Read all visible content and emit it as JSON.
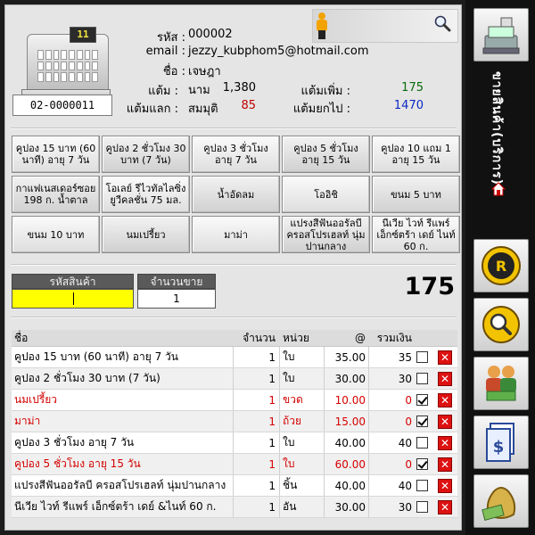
{
  "member": {
    "code_label": "รหัส :",
    "code": "000002",
    "email_label": "email :",
    "email": "jezzy_kubphom5@hotmail.com",
    "name_label": "ชื่อ :",
    "name": "เจษฎา นามสมมุติ",
    "points_label": "แต้ม :",
    "points": "1,380",
    "points_add_label": "แต้มเพิ่ม :",
    "points_add": "175",
    "points_redeem_label": "แต้มแลก :",
    "points_redeem": "85",
    "points_forward_label": "แต้มยกไป :",
    "points_forward": "1470",
    "accent_green": "#0a6a0a",
    "accent_red": "#c00000",
    "accent_blue": "#0b2ac2"
  },
  "register": {
    "display": "11",
    "terminal_id": "02-0000011"
  },
  "products": [
    "คูปอง 15 บาท (60 นาที) อายุ 7 วัน",
    "คูปอง 2 ชั่วโมง 30 บาท (7 วัน)",
    "คูปอง 3 ชั่วโมง อายุ 7 วัน",
    "คูปอง 5 ชั่วโมง อายุ 15 วัน",
    "คูปอง 10 แถม 1 อายุ 15 วัน",
    "กาแฟเนสเดอร์ซอย 198 ก. น้ำตาล",
    "โอเลย์ รีไวทัลไลซิ่ง ยูวีคลชั่น 75 มล.",
    "น้ำอัดลม",
    "โออิชิ",
    "ขนม 5 บาท",
    "ขนม 10 บาท",
    "นมเปรี้ยว",
    "มาม่า",
    "แปรงสีฟันออรัลบี ครอสโปรเฮลท์ นุ่มปานกลาง",
    "นีเวีย ไวท์ รีแพร์ เอ็กซ์ตร้า เดย์ ไนท์ 60 ก."
  ],
  "entry": {
    "code_header": "รหัสสินค้า",
    "qty_header": "จำนวนขาย",
    "code_value": "",
    "qty_value": "1",
    "code_bg": "#ffff00"
  },
  "total": "175",
  "table": {
    "headers": {
      "name": "ชื่อ",
      "qty": "จำนวน",
      "unit": "หน่วย",
      "price": "@",
      "sum": "รวมเงิน"
    },
    "rows": [
      {
        "name": "คูปอง 15 บาท (60 นาที) อายุ 7 วัน",
        "qty": "1",
        "unit": "ใบ",
        "price": "35.00",
        "sum": "35",
        "checked": false,
        "red": false
      },
      {
        "name": "คูปอง 2 ชั่วโมง 30 บาท (7 วัน)",
        "qty": "1",
        "unit": "ใบ",
        "price": "30.00",
        "sum": "30",
        "checked": false,
        "red": false
      },
      {
        "name": "นมเปรี้ยว",
        "qty": "1",
        "unit": "ขวด",
        "price": "10.00",
        "sum": "0",
        "checked": true,
        "red": true
      },
      {
        "name": "มาม่า",
        "qty": "1",
        "unit": "ถ้วย",
        "price": "15.00",
        "sum": "0",
        "checked": true,
        "red": true
      },
      {
        "name": "คูปอง 3 ชั่วโมง อายุ 7 วัน",
        "qty": "1",
        "unit": "ใบ",
        "price": "40.00",
        "sum": "40",
        "checked": false,
        "red": false
      },
      {
        "name": "คูปอง 5 ชั่วโมง อายุ 15 วัน",
        "qty": "1",
        "unit": "ใบ",
        "price": "60.00",
        "sum": "0",
        "checked": true,
        "red": true
      },
      {
        "name": "แปรงสีฟันออรัลบี ครอสโปรเฮลท์ นุ่มปานกลาง",
        "qty": "1",
        "unit": "ชิ้น",
        "price": "40.00",
        "sum": "40",
        "checked": false,
        "red": false
      },
      {
        "name": "นีเวีย ไวท์ รีแพร์ เอ็กซ์ตร้า เดย์ &ไนท์ 60 ก.",
        "qty": "1",
        "unit": "อัน",
        "price": "30.00",
        "sum": "30",
        "checked": false,
        "red": false
      }
    ]
  },
  "sidebar": {
    "title": "ขายสินค้า(บริการ)",
    "icons": [
      "cash-register-icon",
      "vip-card-icon",
      "search-member-icon",
      "users-money-icon",
      "invoice-dollar-icon",
      "money-bag-icon",
      "home-icon"
    ]
  }
}
